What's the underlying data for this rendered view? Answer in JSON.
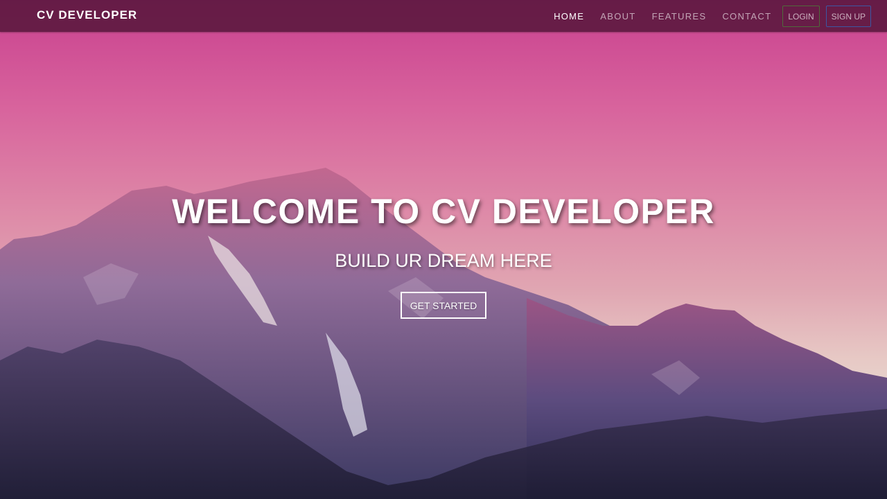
{
  "navbar": {
    "brand": "CV DEVELOPER",
    "links": [
      {
        "label": "HOME",
        "active": true
      },
      {
        "label": "ABOUT",
        "active": false
      },
      {
        "label": "FEATURES",
        "active": false
      },
      {
        "label": "CONTACT",
        "active": false
      }
    ],
    "login_label": "LOGIN",
    "signup_label": "SIGN UP"
  },
  "hero": {
    "title": "WELCOME TO CV DEVELOPER",
    "subtitle": "BUILD UR DREAM HERE",
    "cta_label": "GET STARTED"
  },
  "colors": {
    "navbar_bg": "#501437",
    "sky_top": "#c9418f",
    "sky_bottom": "#e6d7cf",
    "mountain_dark": "#2a2440",
    "mountain_mid": "#6a4a7e",
    "login_border": "#4f6b3a",
    "signup_border": "#3c57a3"
  }
}
